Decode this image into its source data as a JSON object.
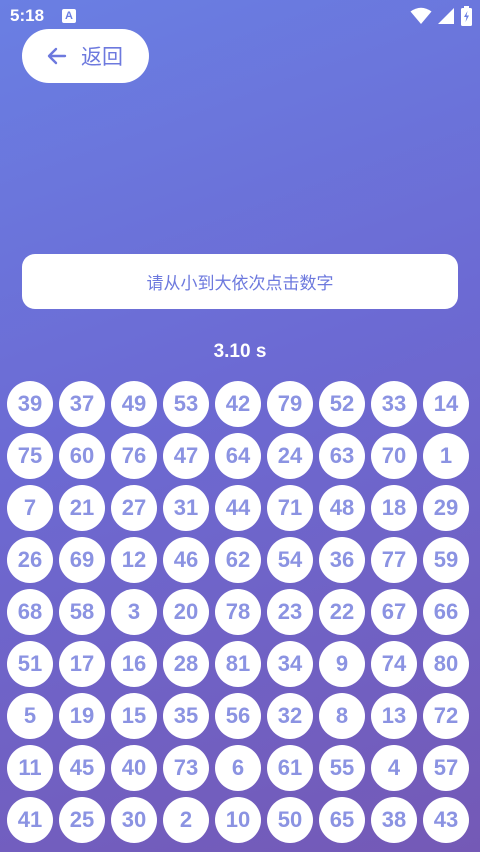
{
  "status_bar": {
    "time": "5:18",
    "notification_icon": "A",
    "icons": [
      "wifi-icon",
      "signal-icon",
      "battery-icon"
    ]
  },
  "back_button": {
    "label": "返回",
    "icon": "arrow-left-icon"
  },
  "instruction": "请从小到大依次点击数字",
  "timer": "3.10 s",
  "colors": {
    "background_start": "#6a7fe3",
    "background_end": "#7459b6",
    "accent": "#6d79de",
    "number": "#8b93e2"
  },
  "numbers": [
    [
      39,
      37,
      49,
      53,
      42,
      79,
      52,
      33,
      14
    ],
    [
      75,
      60,
      76,
      47,
      64,
      24,
      63,
      70,
      1
    ],
    [
      7,
      21,
      27,
      31,
      44,
      71,
      48,
      18,
      29
    ],
    [
      26,
      69,
      12,
      46,
      62,
      54,
      36,
      77,
      59
    ],
    [
      68,
      58,
      3,
      20,
      78,
      23,
      22,
      67,
      66
    ],
    [
      51,
      17,
      16,
      28,
      81,
      34,
      9,
      74,
      80
    ],
    [
      5,
      19,
      15,
      35,
      56,
      32,
      8,
      13,
      72
    ],
    [
      11,
      45,
      40,
      73,
      6,
      61,
      55,
      4,
      57
    ],
    [
      41,
      25,
      30,
      2,
      10,
      50,
      65,
      38,
      43
    ]
  ]
}
